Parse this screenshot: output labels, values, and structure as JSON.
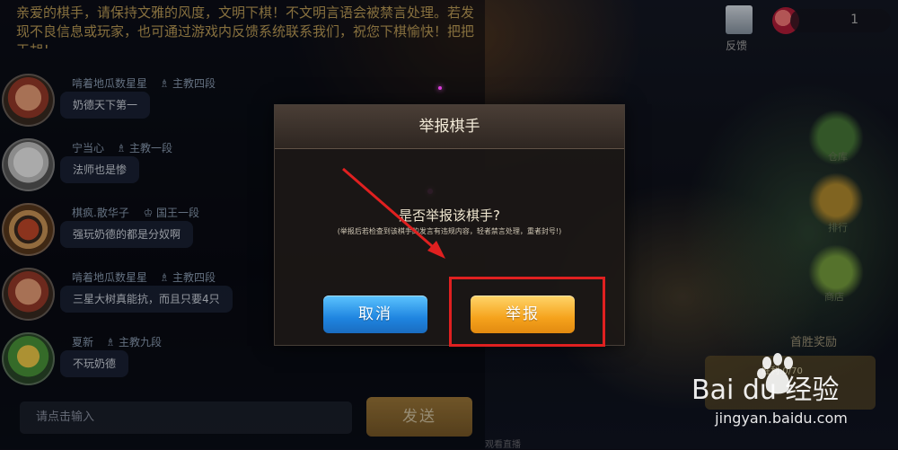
{
  "notice": "亲爱的棋手，请保持文雅的风度，文明下棋！不文明言语会被禁言处理。若发现不良信息或玩家，也可通过游戏内反馈系统联系我们，祝您下棋愉快！把把天胡！",
  "messages": [
    {
      "name": "啃着地瓜数星星",
      "rank": "主教四段",
      "rank_icon": "bishop-icon",
      "text": "奶德天下第一"
    },
    {
      "name": "宁当心",
      "rank": "主教一段",
      "rank_icon": "bishop-icon",
      "text": "法师也是惨"
    },
    {
      "name": "棋疯.散华子",
      "rank": "国王一段",
      "rank_icon": "king-icon",
      "text": "强玩奶德的都是分奴啊"
    },
    {
      "name": "啃着地瓜数星星",
      "rank": "主教四段",
      "rank_icon": "bishop-icon",
      "text": "三星大树真能抗，而且只要4只"
    },
    {
      "name": "夏新",
      "rank": "主教九段",
      "rank_icon": "bishop-icon",
      "text": "不玩奶德"
    }
  ],
  "input": {
    "placeholder": "请点击输入"
  },
  "send_button": "发送",
  "topbar": {
    "value": "1"
  },
  "feedback_label": "反馈",
  "side": {
    "warehouse": "仓库",
    "trophy": "排行",
    "shop": "商店"
  },
  "first_win": "首胜奖励",
  "reward_progress": "胜利:0/70",
  "bottom_hint": "观看直播",
  "dialog": {
    "title": "举报棋手",
    "question": "是否举报该棋手?",
    "note": "(举报后若检查到该棋手的发言有违规内容，轻者禁言处理，重者封号!)",
    "cancel": "取消",
    "report": "举报"
  },
  "watermark": {
    "logo": "Bai du 经验",
    "url": "jingyan.baidu.com"
  },
  "colors": {
    "cancel": "#2a9af0",
    "report": "#f7a61e",
    "highlight": "#e02020",
    "notice": "#c2a15a"
  }
}
